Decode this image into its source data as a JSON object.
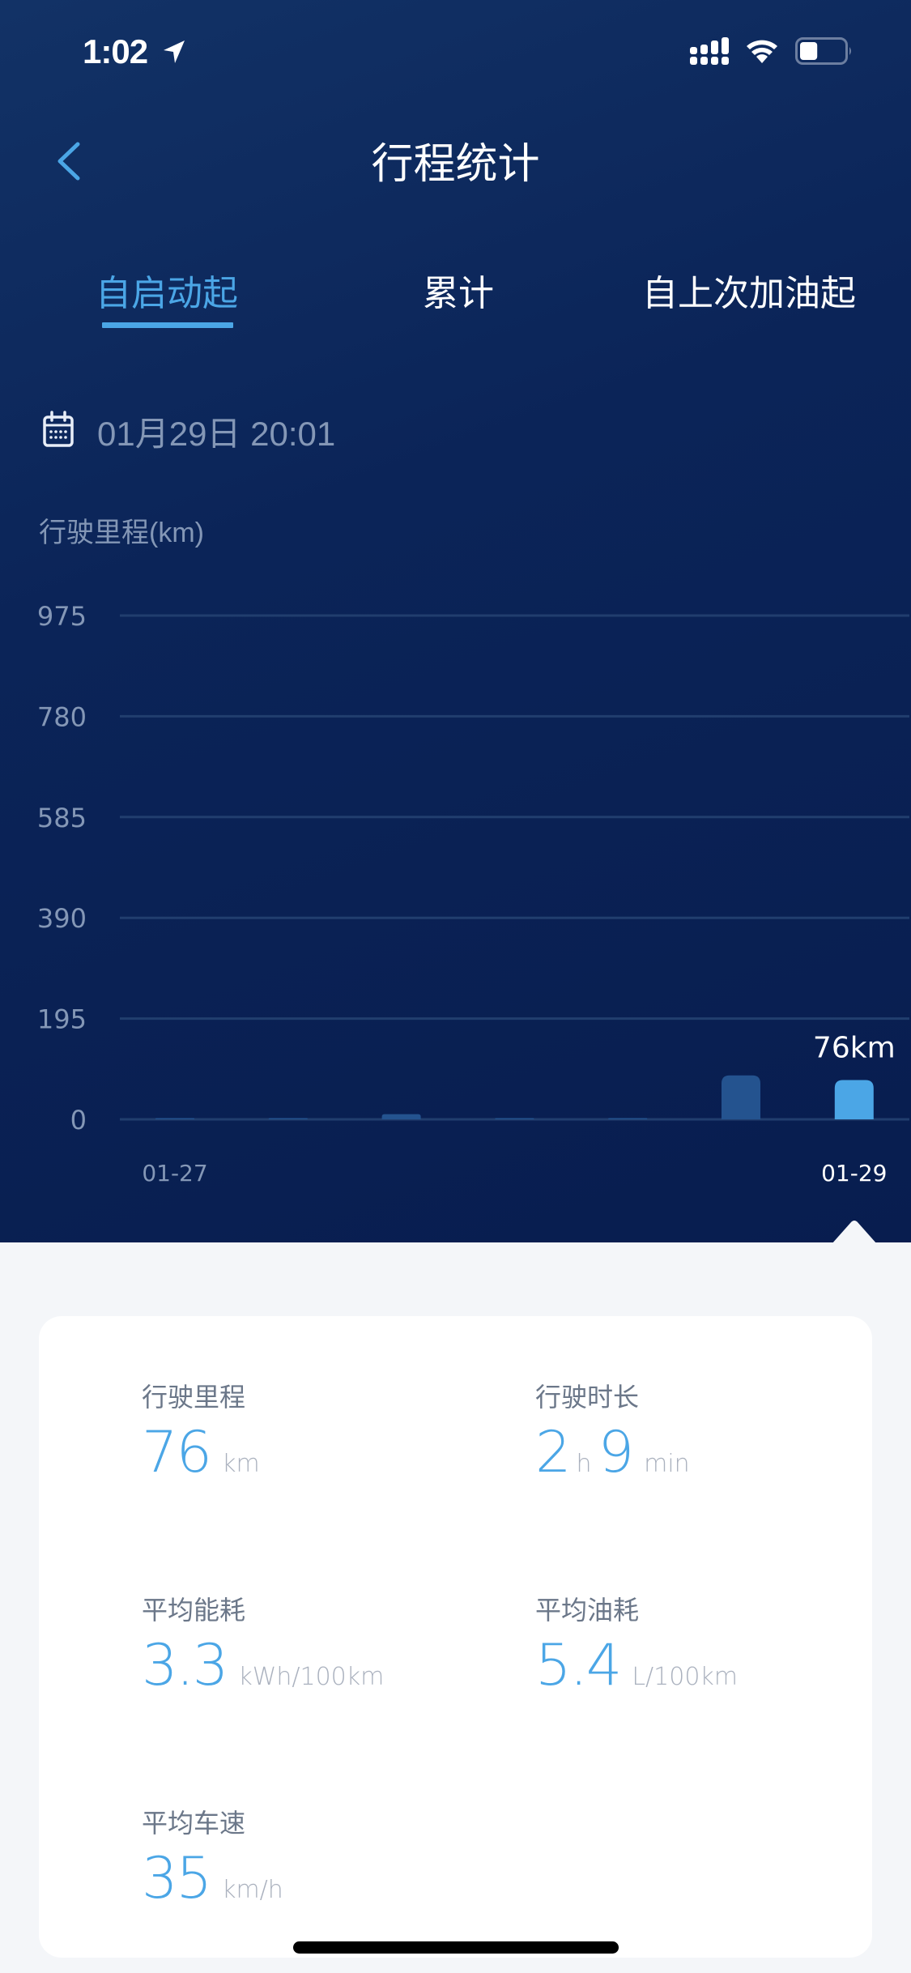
{
  "status_bar": {
    "time": "1:02",
    "location_icon": "location-arrow-icon",
    "signal_icon": "signal-icon",
    "wifi_icon": "wifi-icon",
    "battery_icon": "battery-icon",
    "battery_level": 0.4
  },
  "nav": {
    "back_icon": "chevron-left-icon",
    "title": "行程统计"
  },
  "tabs": [
    {
      "label": "自启动起",
      "active": true
    },
    {
      "label": "累计",
      "active": false
    },
    {
      "label": "自上次加油起",
      "active": false
    }
  ],
  "date_selector": {
    "icon": "calendar-icon",
    "value": "01月29日 20:01"
  },
  "chart_data": {
    "type": "bar",
    "title": "",
    "ylabel": "行驶里程(km)",
    "xlabel": "",
    "ylim": [
      0,
      975
    ],
    "yticks": [
      0,
      195,
      390,
      585,
      780,
      975
    ],
    "grid": true,
    "categories": [
      "",
      "",
      "",
      "",
      "",
      "",
      ""
    ],
    "x_tick_labels": [
      {
        "index": 0,
        "label": "01-27"
      },
      {
        "index": 6,
        "label": "01-29"
      }
    ],
    "values": [
      2,
      1,
      10,
      1,
      1,
      85,
      76
    ],
    "selected_index": 6,
    "selected_label": "76km",
    "colors": {
      "bar": "#24538f",
      "bar_selected": "#4ba6e6",
      "grid": "#213e6e",
      "tick": "#8497b6"
    }
  },
  "stats": [
    {
      "label": "行驶里程",
      "parts": [
        {
          "v": "76",
          "t": "num"
        },
        {
          "v": "km",
          "t": "unit"
        }
      ]
    },
    {
      "label": "行驶时长",
      "parts": [
        {
          "v": "2",
          "t": "num"
        },
        {
          "v": "h",
          "t": "unit"
        },
        {
          "v": "9",
          "t": "num"
        },
        {
          "v": "min",
          "t": "unit"
        }
      ]
    },
    {
      "label": "平均能耗",
      "parts": [
        {
          "v": "3.3",
          "t": "num"
        },
        {
          "v": "kWh/100km",
          "t": "unit"
        }
      ]
    },
    {
      "label": "平均油耗",
      "parts": [
        {
          "v": "5.4",
          "t": "num"
        },
        {
          "v": "L/100km",
          "t": "unit"
        }
      ]
    },
    {
      "label": "平均车速",
      "parts": [
        {
          "v": "35",
          "t": "num"
        },
        {
          "v": "km/h",
          "t": "unit"
        }
      ]
    }
  ],
  "colors": {
    "accent": "#4ba6e6",
    "hero_bg": "#0b2458",
    "page_bg": "#f4f6f9",
    "label": "#6b7789",
    "unit": "#aab1be"
  }
}
